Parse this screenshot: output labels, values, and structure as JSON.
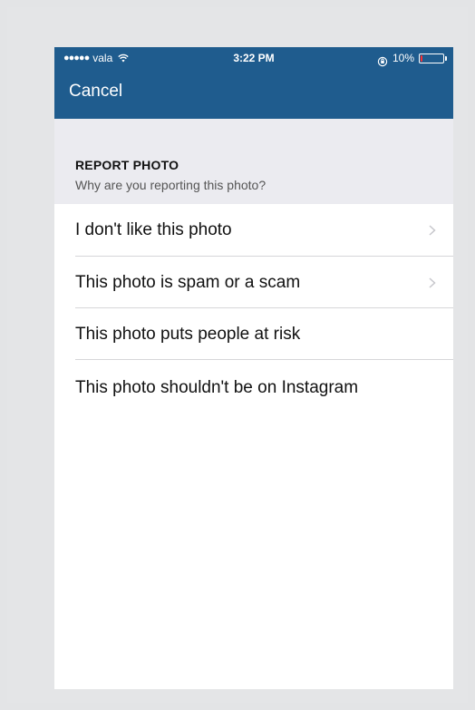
{
  "status_bar": {
    "signal_dots": "●●●●●",
    "carrier": "vala",
    "time": "3:22 PM",
    "battery_percent": "10%",
    "battery_level": 0.1,
    "battery_fill_color": "#ff2e2e"
  },
  "nav": {
    "cancel_label": "Cancel",
    "bar_color": "#1f5c8e"
  },
  "report": {
    "title": "REPORT PHOTO",
    "subtitle": "Why are you reporting this photo?"
  },
  "options": [
    {
      "label": "I don't like this photo",
      "has_chevron": true
    },
    {
      "label": "This photo is spam or a scam",
      "has_chevron": true
    },
    {
      "label": "This photo puts people at risk",
      "has_chevron": false
    },
    {
      "label": "This photo shouldn't be on Instagram",
      "has_chevron": false
    }
  ]
}
